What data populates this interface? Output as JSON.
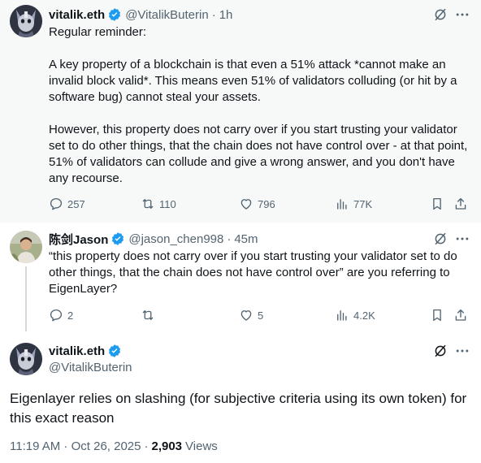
{
  "tweet1": {
    "display_name": "vitalik.eth",
    "handle": "@VitalikButerin",
    "separator": "·",
    "time": "1h",
    "paragraphs": [
      "Regular reminder:",
      "A key property of a blockchain is that even a 51% attack *cannot make an invalid block valid*. This means even 51% of validators colluding (or hit by a software bug) cannot steal your assets.",
      "However, this property does not carry over if you start trusting your validator set to do other things, that the chain does not have control over - at that point, 51% of validators can collude and give a wrong answer, and you don't have any recourse."
    ],
    "replies": "257",
    "reposts": "110",
    "likes": "796",
    "views": "77K"
  },
  "tweet2": {
    "display_name": "陈剑Jason",
    "handle": "@jason_chen998",
    "separator": "·",
    "time": "45m",
    "text": "“this property does not carry over if you start trusting your validator set to do other things, that the chain does not have control over” are you referring to EigenLayer?",
    "replies": "2",
    "reposts": "",
    "likes": "5",
    "views": "4.2K"
  },
  "tweet3": {
    "display_name": "vitalik.eth",
    "handle": "@VitalikButerin",
    "text": "Eigenlayer relies on slashing (for subjective criteria using its own token) for this exact reason",
    "timestamp": "11:19 AM · Oct 26, 2025",
    "separator": "·",
    "views_count": "2,903",
    "views_label": "Views"
  },
  "colors": {
    "verified": "#1d9bf0",
    "secondary_text": "#536471",
    "highlight_bg": "#f7f9f9"
  }
}
